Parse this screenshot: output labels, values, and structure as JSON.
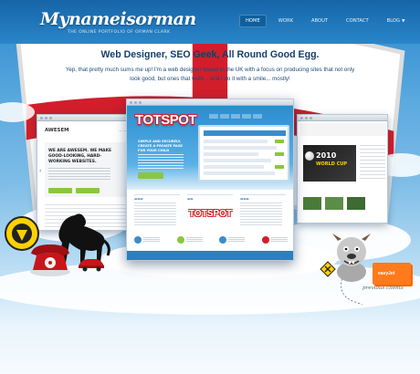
{
  "header": {
    "logo_text": "Mynameisorman",
    "tagline": "THE ONLINE PORTFOLIO OF ORMAN CLARK"
  },
  "nav": {
    "items": [
      {
        "label": "HOME",
        "active": true
      },
      {
        "label": "WORK",
        "active": false
      },
      {
        "label": "ABOUT",
        "active": false
      },
      {
        "label": "CONTACT",
        "active": false
      },
      {
        "label": "BLOG",
        "active": false
      }
    ]
  },
  "hero": {
    "headline": "Web Designer, SEO Geek, All Round Good Egg.",
    "intro": "Yep, that pretty much sums me up! I'm a web designer based in the UK with a focus on producing sites that not only look good, but ones that work... and I do it with a smile... mostly!"
  },
  "showcase": {
    "left_site": {
      "brand": "AWESEM",
      "heading": "WE ARE AWESEM. WE MAKE GOOD-LOOKING, HARD-WORKING WEBSITES."
    },
    "center_site": {
      "logo": "TOTSPOT",
      "tagline": "SIMPLE AND SECURELY, CREATE A PRIVATE PAGE FOR YOUR CHILD"
    },
    "right_site": {
      "banner_title": "2010",
      "banner_sub": "WORLD CUP"
    }
  },
  "previous_clients": {
    "label": "previous clients",
    "card_text": "easyJet"
  },
  "colors": {
    "accent_blue": "#1f7fc4",
    "nav_active": "#0f5f9e",
    "headline": "#163d6b",
    "tots_red": "#d21e2b",
    "green_button": "#8cc63f"
  }
}
